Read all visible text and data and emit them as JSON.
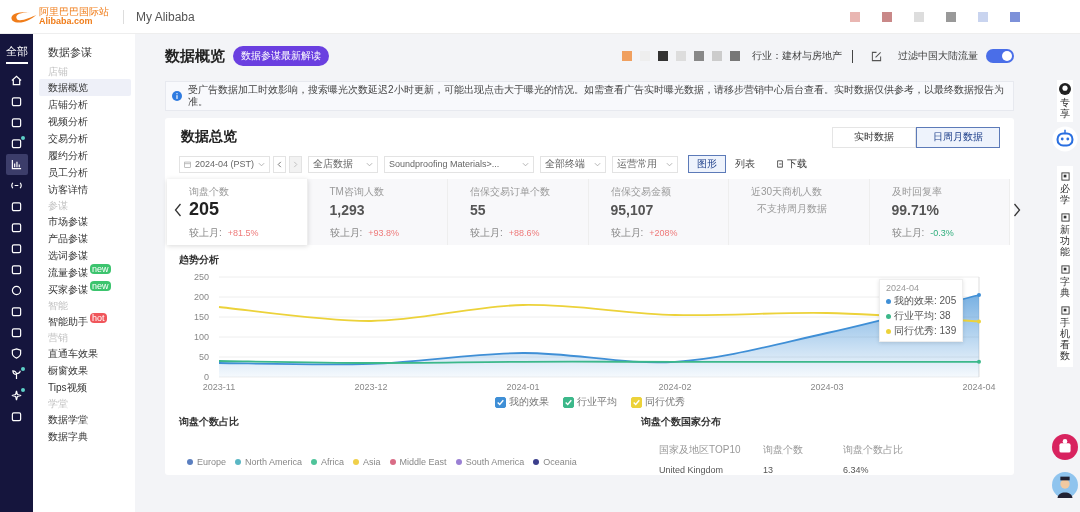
{
  "header": {
    "logo_cn": "阿里巴巴国际站",
    "logo_en": "Alibaba.com",
    "app_name": "My Alibaba"
  },
  "rail": {
    "label": "全部",
    "items": [
      {
        "selected": false,
        "dot": false
      },
      {
        "selected": false,
        "dot": false
      },
      {
        "selected": false,
        "dot": false
      },
      {
        "selected": false,
        "dot": true
      },
      {
        "selected": true,
        "dot": false
      },
      {
        "selected": false,
        "dot": false
      },
      {
        "selected": false,
        "dot": false
      },
      {
        "selected": false,
        "dot": false
      },
      {
        "selected": false,
        "dot": false
      },
      {
        "selected": false,
        "dot": false
      },
      {
        "selected": false,
        "dot": false
      },
      {
        "selected": false,
        "dot": false
      },
      {
        "selected": false,
        "dot": false
      },
      {
        "selected": false,
        "dot": false
      },
      {
        "selected": false,
        "dot": true
      },
      {
        "selected": false,
        "dot": true
      },
      {
        "selected": false,
        "dot": false
      }
    ]
  },
  "sidebar": {
    "title": "数据参谋",
    "groups": [
      {
        "label": "店铺",
        "items": [
          {
            "label": "数据概览",
            "selected": true
          },
          {
            "label": "店铺分析",
            "selected": false
          },
          {
            "label": "视频分析",
            "selected": false
          },
          {
            "label": "交易分析",
            "selected": false
          },
          {
            "label": "履约分析",
            "selected": false
          },
          {
            "label": "员工分析",
            "selected": false
          },
          {
            "label": "访客详情",
            "selected": false
          }
        ]
      },
      {
        "label": "参谋",
        "items": [
          {
            "label": "市场参谋",
            "selected": false
          },
          {
            "label": "产品参谋",
            "selected": false
          },
          {
            "label": "选词参谋",
            "selected": false
          },
          {
            "label": "流量参谋",
            "selected": false,
            "badge": {
              "text": "new",
              "color": "#3cc46e"
            }
          },
          {
            "label": "买家参谋",
            "selected": false,
            "badge": {
              "text": "new",
              "color": "#3cc46e"
            }
          }
        ]
      },
      {
        "label": "智能",
        "items": [
          {
            "label": "智能助手",
            "selected": false,
            "badge": {
              "text": "hot",
              "color": "#f0565b"
            }
          }
        ]
      },
      {
        "label": "营销",
        "items": [
          {
            "label": "直通车效果",
            "selected": false
          },
          {
            "label": "橱窗效果",
            "selected": false
          },
          {
            "label": "Tips视频",
            "selected": false
          }
        ]
      },
      {
        "label": "学堂",
        "items": [
          {
            "label": "数据学堂",
            "selected": false
          },
          {
            "label": "数据字典",
            "selected": false
          }
        ]
      }
    ]
  },
  "page": {
    "title": "数据概览",
    "pill": "数据参谋最新解读",
    "industry": "行业：建材与房地产",
    "filter_label": "过滤中国大陆流量",
    "filter_on": true
  },
  "notice": "受广告数据加工时效影响，搜索曝光次数延迟2小时更新，可能出现点击大于曝光的情况。如需查看广告实时曝光数据，请移步营销中心后台查看。实时数据仅供参考，以最终数据报告为准。",
  "overview": {
    "title": "数据总览",
    "modes": [
      {
        "label": "实时数据",
        "selected": false
      },
      {
        "label": "日周月数据",
        "selected": true
      }
    ],
    "date": "2024-04 (PST)",
    "selects": [
      "全店数据",
      "Soundproofing Materials>...",
      "全部终端",
      "运营常用"
    ],
    "views": [
      {
        "label": "图形",
        "selected": true
      },
      {
        "label": "列表",
        "selected": false
      }
    ],
    "download": "下载",
    "metrics": [
      {
        "label": "询盘个数",
        "value": "205",
        "compare": "较上月:",
        "delta": "+81.5%",
        "up": true,
        "selected": true
      },
      {
        "label": "TM咨询人数",
        "value": "1,293",
        "compare": "较上月:",
        "delta": "+93.8%",
        "up": true,
        "selected": false
      },
      {
        "label": "信保交易订单个数",
        "value": "55",
        "compare": "较上月:",
        "delta": "+88.6%",
        "up": true,
        "selected": false
      },
      {
        "label": "信保交易金额",
        "value": "95,107",
        "compare": "较上月:",
        "delta": "+208%",
        "up": true,
        "selected": false
      },
      {
        "label": "近30天商机人数",
        "note": "不支持周月数据",
        "selected": false
      },
      {
        "label": "及时回复率",
        "value": "99.71%",
        "compare": "较上月:",
        "delta": "-0.3%",
        "up": false,
        "selected": false
      }
    ]
  },
  "trend": {
    "title": "趋势分析",
    "legend_checked": [
      true,
      true,
      true
    ],
    "chart_data": {
      "type": "line",
      "grid": true,
      "categories": [
        "2023-11",
        "2023-12",
        "2024-01",
        "2024-02",
        "2024-03",
        "2024-04"
      ],
      "ylim": [
        0,
        250
      ],
      "yticks": [
        0,
        50,
        100,
        150,
        200,
        250
      ],
      "series": [
        {
          "name": "我的效果",
          "type": "area",
          "color": "#3f8fd6",
          "values": [
            35,
            33,
            60,
            38,
            110,
            205
          ]
        },
        {
          "name": "行业平均",
          "type": "line",
          "color": "#3cb88a",
          "values": [
            40,
            35,
            38,
            38,
            38,
            38
          ]
        },
        {
          "name": "同行优秀",
          "type": "line",
          "color": "#ecd23a",
          "values": [
            175,
            140,
            180,
            155,
            160,
            139
          ]
        }
      ]
    },
    "tooltip": {
      "title": "2024-04",
      "items": [
        {
          "label": "我的效果: 205",
          "color": "#3f8fd6"
        },
        {
          "label": "行业平均: 38",
          "color": "#3cb88a"
        },
        {
          "label": "同行优秀: 139",
          "color": "#ecd23a"
        }
      ]
    }
  },
  "share": {
    "title": "询盘个数占比",
    "legend": [
      {
        "label": "Europe",
        "color": "#5b7fc0"
      },
      {
        "label": "North America",
        "color": "#5ab7c4"
      },
      {
        "label": "Africa",
        "color": "#4fc49a"
      },
      {
        "label": "Asia",
        "color": "#f0d04a"
      },
      {
        "label": "Middle East",
        "color": "#d96c86"
      },
      {
        "label": "South America",
        "color": "#9a80d4"
      },
      {
        "label": "Oceania",
        "color": "#3c3f8c"
      }
    ]
  },
  "countries": {
    "title": "询盘个数国家分布",
    "columns": [
      "国家及地区TOP10",
      "询盘个数",
      "询盘个数占比"
    ],
    "rows": [
      [
        "United Kingdom",
        "13",
        "6.34%"
      ]
    ]
  },
  "toolbar": {
    "top": "专享",
    "items": [
      "必学",
      "新功能",
      "字典",
      "手机看数"
    ]
  }
}
